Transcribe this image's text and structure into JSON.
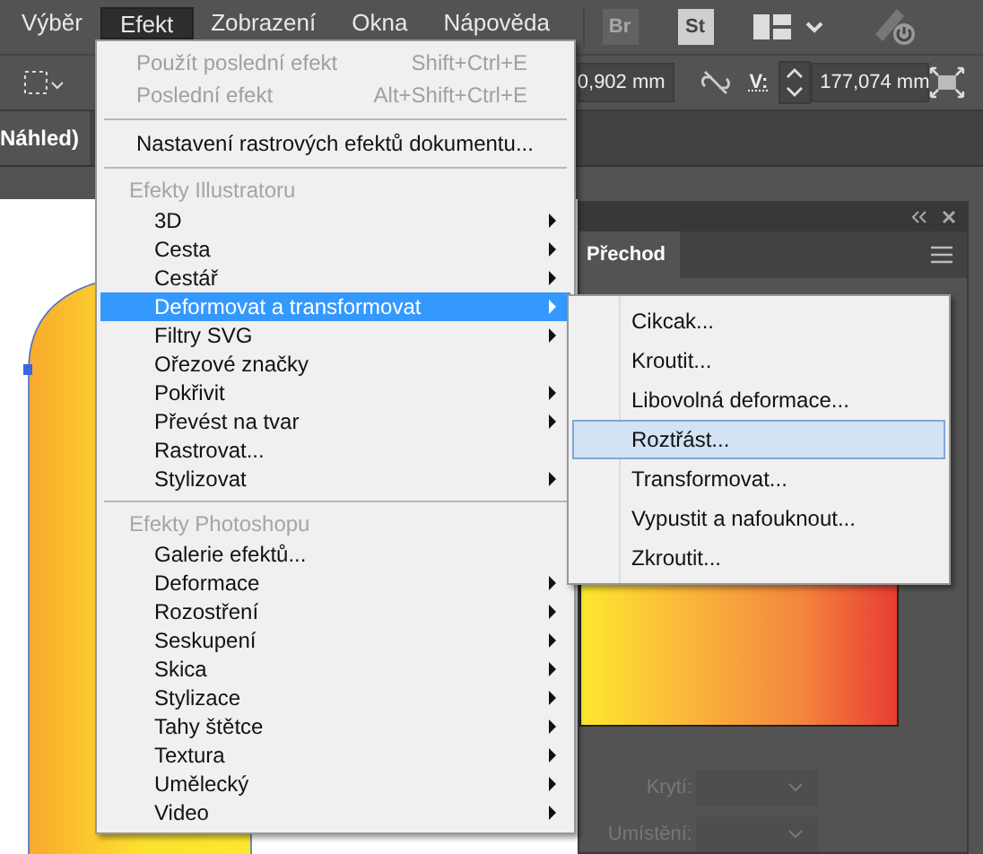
{
  "menubar": [
    {
      "label": "Výběr",
      "selected": false
    },
    {
      "label": "Efekt",
      "selected": true
    },
    {
      "label": "Zobrazení",
      "selected": false
    },
    {
      "label": "Okna",
      "selected": false
    },
    {
      "label": "Nápověda",
      "selected": false
    }
  ],
  "app_buttons": [
    {
      "label": "Br",
      "disabled": true
    },
    {
      "label": "St",
      "disabled": false
    }
  ],
  "toolbar": {
    "width_value": "0,902 mm",
    "height_label": "V:",
    "height_value": "177,074 mm"
  },
  "document_tab": "Náhled)",
  "effect_menu": [
    {
      "kind": "item",
      "label": "Použít poslední efekt",
      "shortcut": "Shift+Ctrl+E",
      "disabled": true,
      "submenu": false,
      "selected": false
    },
    {
      "kind": "item",
      "label": "Poslední efekt",
      "shortcut": "Alt+Shift+Ctrl+E",
      "disabled": true,
      "submenu": false,
      "selected": false
    },
    {
      "kind": "separator"
    },
    {
      "kind": "item",
      "label": "Nastavení rastrových efektů dokumentu...",
      "disabled": false,
      "submenu": false,
      "selected": false
    },
    {
      "kind": "separator"
    },
    {
      "kind": "header",
      "label": "Efekty Illustratoru"
    },
    {
      "kind": "item",
      "label": "3D",
      "disabled": false,
      "submenu": true,
      "selected": false
    },
    {
      "kind": "item",
      "label": "Cesta",
      "disabled": false,
      "submenu": true,
      "selected": false
    },
    {
      "kind": "item",
      "label": "Cestář",
      "disabled": false,
      "submenu": true,
      "selected": false
    },
    {
      "kind": "item",
      "label": "Deformovat a transformovat",
      "disabled": false,
      "submenu": true,
      "selected": true
    },
    {
      "kind": "item",
      "label": "Filtry SVG",
      "disabled": false,
      "submenu": true,
      "selected": false
    },
    {
      "kind": "item",
      "label": "Ořezové značky",
      "disabled": false,
      "submenu": false,
      "selected": false
    },
    {
      "kind": "item",
      "label": "Pokřivit",
      "disabled": false,
      "submenu": true,
      "selected": false
    },
    {
      "kind": "item",
      "label": "Převést na tvar",
      "disabled": false,
      "submenu": true,
      "selected": false
    },
    {
      "kind": "item",
      "label": "Rastrovat...",
      "disabled": false,
      "submenu": false,
      "selected": false
    },
    {
      "kind": "item",
      "label": "Stylizovat",
      "disabled": false,
      "submenu": true,
      "selected": false
    },
    {
      "kind": "separator"
    },
    {
      "kind": "header",
      "label": "Efekty Photoshopu"
    },
    {
      "kind": "item",
      "label": "Galerie efektů...",
      "disabled": false,
      "submenu": false,
      "selected": false
    },
    {
      "kind": "item",
      "label": "Deformace",
      "disabled": false,
      "submenu": true,
      "selected": false
    },
    {
      "kind": "item",
      "label": "Rozostření",
      "disabled": false,
      "submenu": true,
      "selected": false
    },
    {
      "kind": "item",
      "label": "Seskupení",
      "disabled": false,
      "submenu": true,
      "selected": false
    },
    {
      "kind": "item",
      "label": "Skica",
      "disabled": false,
      "submenu": true,
      "selected": false
    },
    {
      "kind": "item",
      "label": "Stylizace",
      "disabled": false,
      "submenu": true,
      "selected": false
    },
    {
      "kind": "item",
      "label": "Tahy štětce",
      "disabled": false,
      "submenu": true,
      "selected": false
    },
    {
      "kind": "item",
      "label": "Textura",
      "disabled": false,
      "submenu": true,
      "selected": false
    },
    {
      "kind": "item",
      "label": "Umělecký",
      "disabled": false,
      "submenu": true,
      "selected": false
    },
    {
      "kind": "item",
      "label": "Video",
      "disabled": false,
      "submenu": true,
      "selected": false
    }
  ],
  "submenu": [
    {
      "label": "Cikcak...",
      "selected": false
    },
    {
      "label": "Kroutit...",
      "selected": false
    },
    {
      "label": "Libovolná deformace...",
      "selected": false
    },
    {
      "label": "Roztřást...",
      "selected": true
    },
    {
      "label": "Transformovat...",
      "selected": false
    },
    {
      "label": "Vypustit a nafouknout...",
      "selected": false
    },
    {
      "label": "Zkroutit...",
      "selected": false
    }
  ],
  "panel": {
    "tab": "Přechod",
    "fields": [
      {
        "label": "Krytí:",
        "disabled": true
      },
      {
        "label": "Umístění:",
        "disabled": true
      }
    ]
  }
}
